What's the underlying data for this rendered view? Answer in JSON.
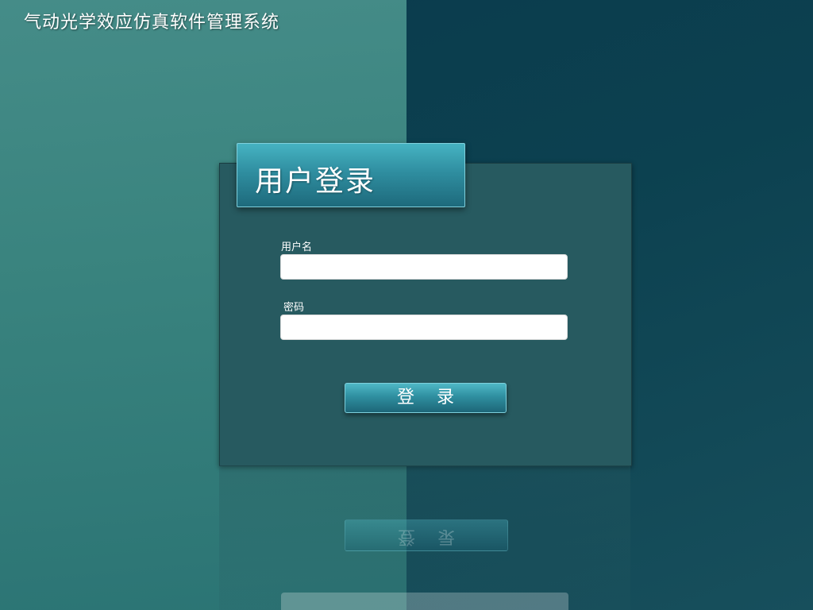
{
  "app": {
    "title": "气动光学效应仿真软件管理系统"
  },
  "login": {
    "header": "用户登录",
    "username_label": "用户名",
    "username_value": "",
    "password_label": "密码",
    "password_value": "",
    "submit_label": "登    录"
  },
  "colors": {
    "background_left": "#3f8985",
    "background_right": "#0b3d4e",
    "panel": "#275a60",
    "accent": "#2f8ea0",
    "input_background": "#ffffff",
    "text": "#ffffff"
  }
}
